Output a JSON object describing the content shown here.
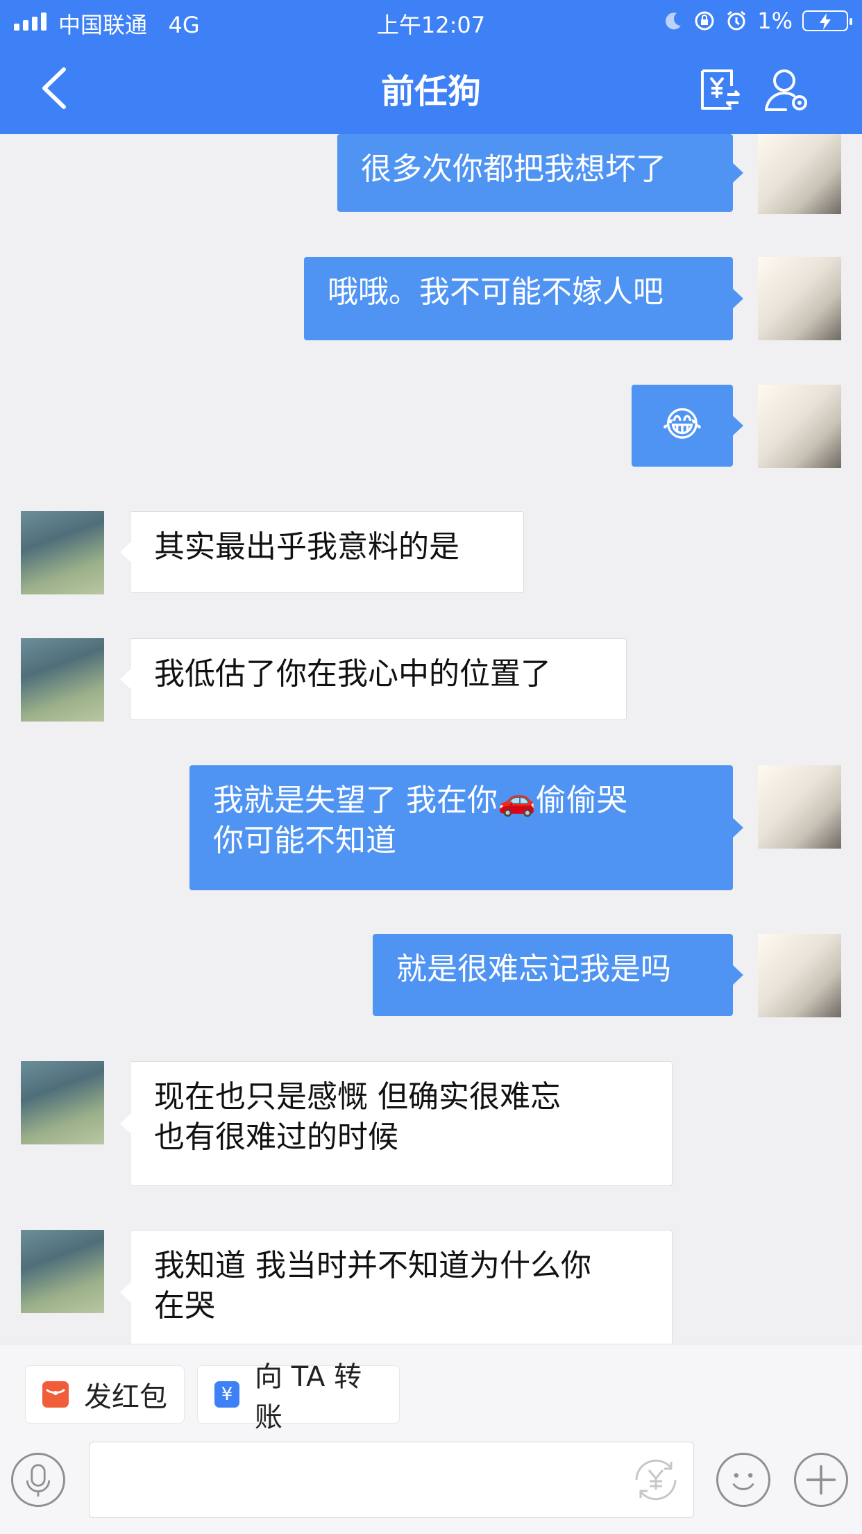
{
  "status_bar": {
    "carrier": "中国联通",
    "network": "4G",
    "time": "上午12:07",
    "battery": "1%"
  },
  "header": {
    "title": "前任狗",
    "back_icon": "chevron-left-icon",
    "right_icons": [
      "transfer-icon",
      "profile-icon"
    ]
  },
  "messages": [
    {
      "sender": "self",
      "text": "很多次你都把我想坏了"
    },
    {
      "sender": "self",
      "text": "哦哦。我不可能不嫁人吧"
    },
    {
      "sender": "self",
      "text": "😂"
    },
    {
      "sender": "other",
      "text": "其实最出乎我意料的是"
    },
    {
      "sender": "other",
      "text": "我低估了你在我心中的位置了"
    },
    {
      "sender": "self",
      "line1": "我就是失望了 我在你🚗偷偷哭",
      "line2": "你可能不知道"
    },
    {
      "sender": "self",
      "text": "就是很难忘记我是吗"
    },
    {
      "sender": "other",
      "line1": "现在也只是感慨  但确实很难忘",
      "line2": "也有很难过的时候"
    },
    {
      "sender": "other",
      "line1": "我知道 我当时并不知道为什么你",
      "line2": "在哭"
    }
  ],
  "bottom_bar": {
    "red_packet_label": "发红包",
    "transfer_label": "向 TA 转账",
    "input_value": "",
    "icons": [
      "microphone-icon",
      "yuan-icon",
      "emoji-icon",
      "plus-icon"
    ]
  },
  "colors": {
    "header_blue": "#3e80f5",
    "self_bubble": "#4f94f3",
    "other_bubble": "#ffffff",
    "background": "#f0f0f2"
  }
}
